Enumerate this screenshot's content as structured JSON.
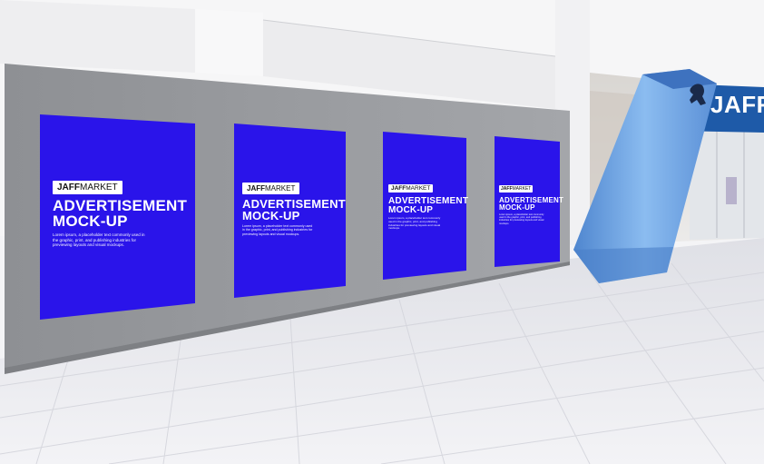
{
  "scene": {
    "description_colors": {
      "wall": "#9a9ca0",
      "poster": "#2a14ea",
      "floor": "#e8e9ee",
      "arch": "#6aa2e0",
      "sign_band": "#1e5aa8"
    }
  },
  "posters": [
    {
      "logo_bold": "JAFF",
      "logo_light": "MARKET",
      "headline_1": "ADVERTISEMENT",
      "headline_2": "MOCK-UP",
      "body": "Lorem ipsum, a placeholder text commonly used in the graphic, print, and publishing industries for previewing layouts and visual mockups."
    },
    {
      "logo_bold": "JAFF",
      "logo_light": "MARKET",
      "headline_1": "ADVERTISEMENT",
      "headline_2": "MOCK-UP",
      "body": "Lorem ipsum, a placeholder text commonly used in the graphic, print, and publishing industries for previewing layouts and visual mockups."
    },
    {
      "logo_bold": "JAFF",
      "logo_light": "MARKET",
      "headline_1": "ADVERTISEMENT",
      "headline_2": "MOCK-UP",
      "body": "Lorem ipsum, a placeholder text commonly used in the graphic, print, and publishing industries for previewing layouts and visual mockups."
    },
    {
      "logo_bold": "JAFF",
      "logo_light": "MARKET",
      "headline_1": "ADVERTISEMENT",
      "headline_2": "MOCK-UP",
      "body": "Lorem ipsum, a placeholder text commonly used in the graphic, print, and publishing industries for previewing layouts and visual mockups."
    }
  ],
  "arch_sign": {
    "text": "JAFF"
  }
}
